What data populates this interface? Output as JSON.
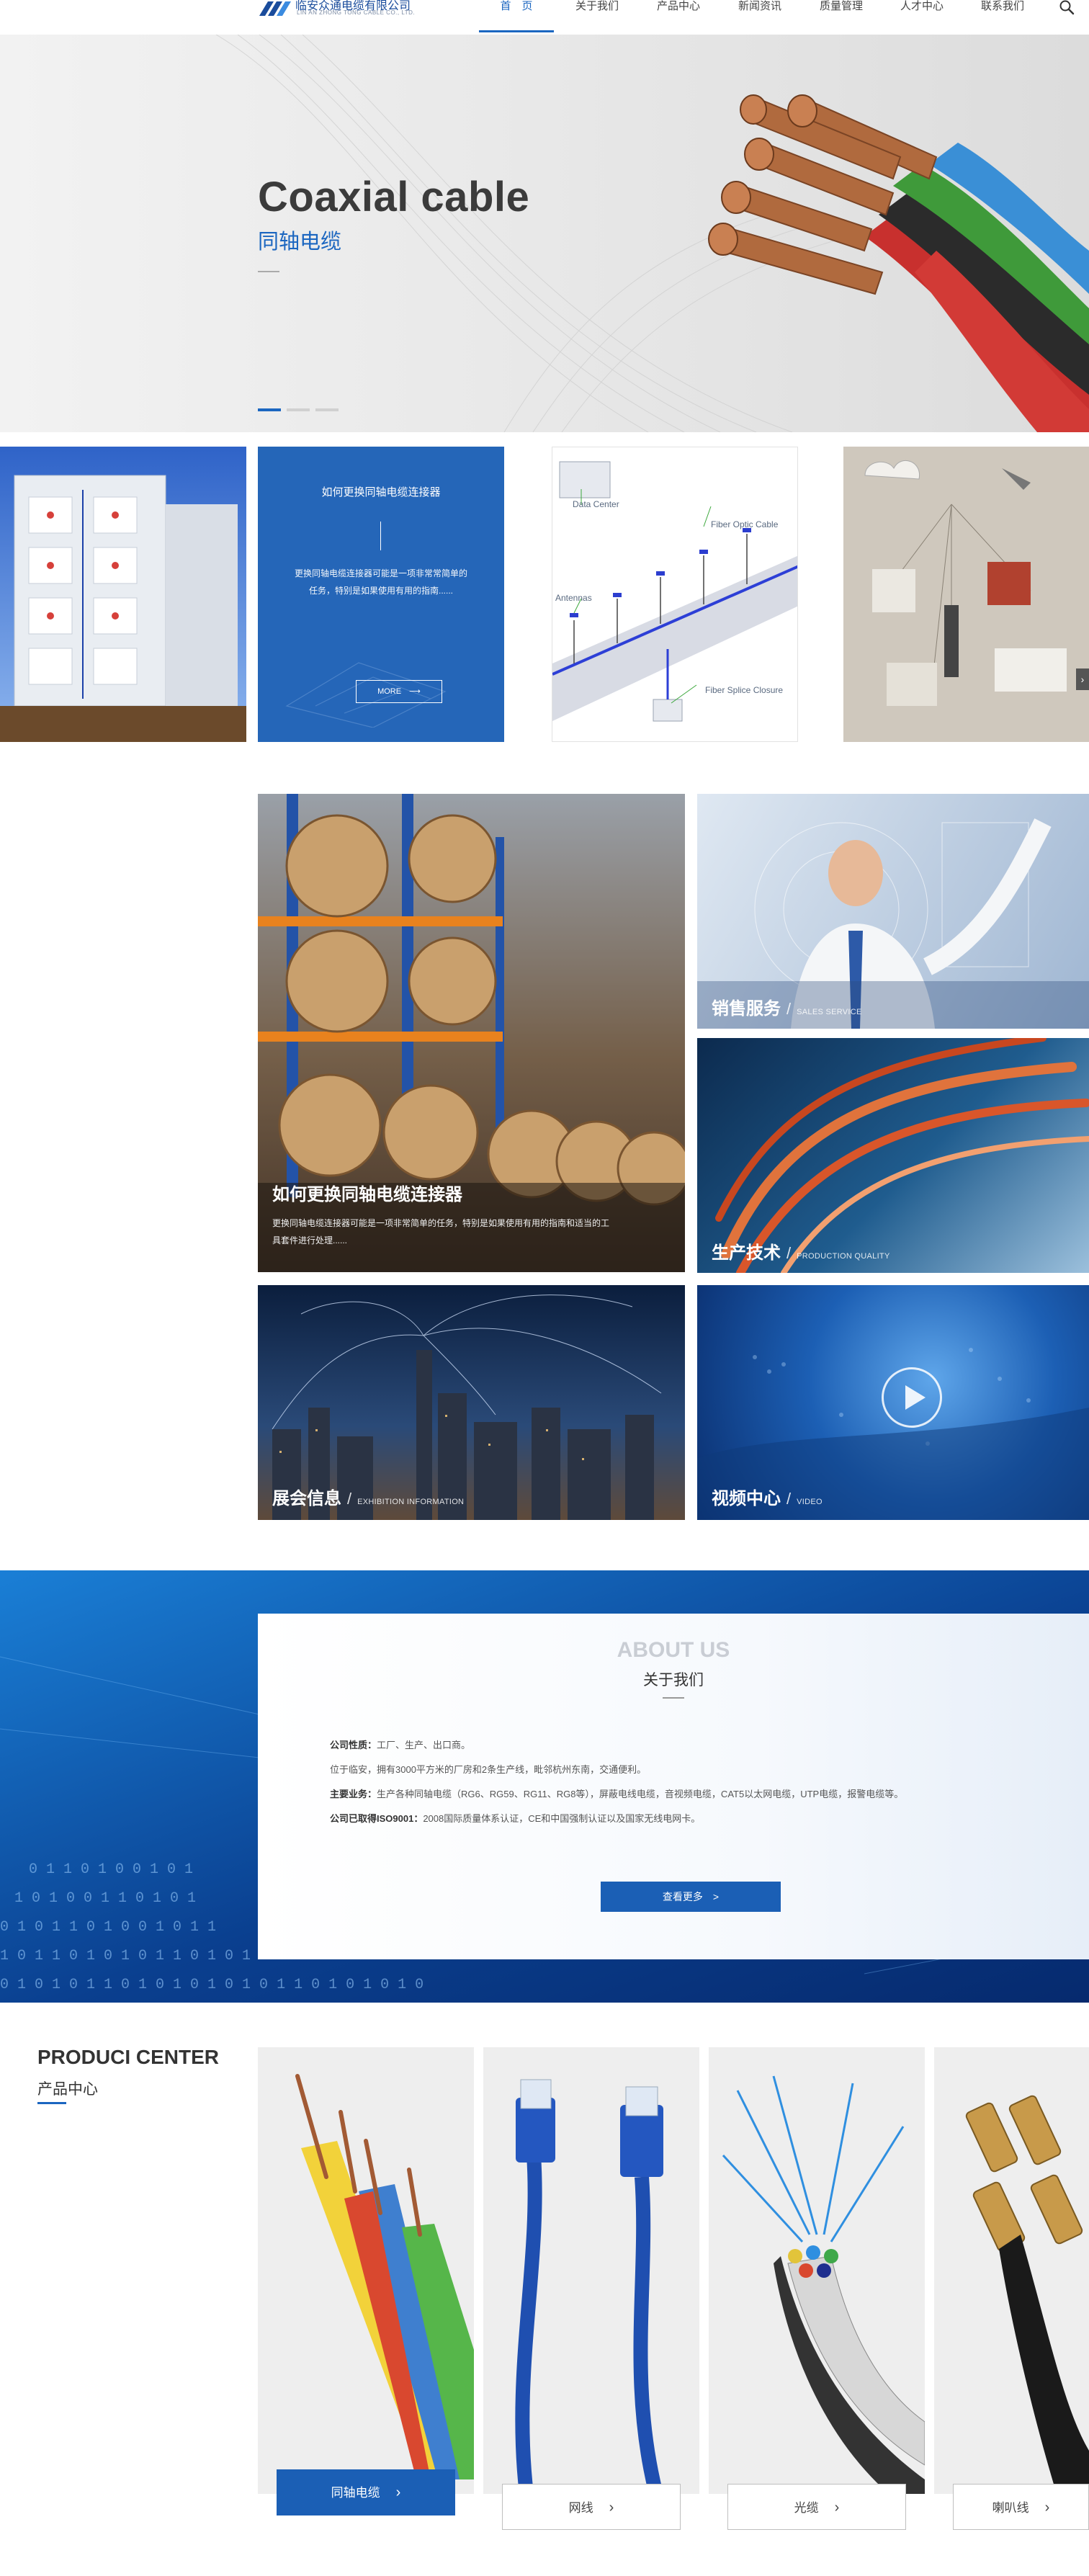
{
  "brand": {
    "name_cn": "临安众通电缆有限公司",
    "name_en": "LIN AN ZHONG TONG CABLE CO., LTD."
  },
  "nav": {
    "items": [
      "首　页",
      "关于我们",
      "产品中心",
      "新闻资讯",
      "质量管理",
      "人才中心",
      "联系我们"
    ],
    "active_index": 0,
    "search_icon": "search-icon"
  },
  "hero": {
    "title": "Coaxial cable",
    "subtitle": "同轴电缆",
    "slides_total": 3,
    "active_slide": 1
  },
  "cards": {
    "feature_title": "如何更换同轴电缆连接器",
    "feature_text": "更换同轴电缆连接器可能是一项非常常简单的任务，特别是如果使用有用的指南......",
    "feature_button": "MORE",
    "diagram_labels": {
      "data_center": "Data Center",
      "fiber_optic": "Fiber Optic Cable",
      "antennas": "Antennas",
      "closure": "Fiber Splice Closure"
    }
  },
  "grid": {
    "warehouse": {
      "title": "如何更换同轴电缆连接器",
      "text": "更换同轴电缆连接器可能是一项非常简单的任务，特别是如果使用有用的指南和适当的工具套件进行处理......"
    },
    "sales": {
      "cn": "销售服务",
      "sep": "/",
      "en": "SALES SERVICE"
    },
    "production": {
      "cn": "生产技术",
      "sep": "/",
      "en": "PRODUCTION QUALITY"
    },
    "exhibition": {
      "cn": "展会信息",
      "sep": "/",
      "en": "EXHIBITION INFORMATION"
    },
    "video": {
      "cn": "视频中心",
      "sep": "/",
      "en": "VIDEO"
    }
  },
  "about": {
    "heading_en": "ABOUT US",
    "heading_cn": "关于我们",
    "lines": [
      {
        "label": "公司性质：",
        "text": "工厂、生产、出口商。"
      },
      {
        "label": "",
        "text": "位于临安，拥有3000平方米的厂房和2条生产线，毗邻杭州东南，交通便利。"
      },
      {
        "label": "主要业务：",
        "text": "生产各种同轴电缆（RG6、RG59、RG11、RG8等），屏蔽电线电缆，音视频电缆，CAT5以太网电缆，UTP电缆，报警电缆等。"
      },
      {
        "label": "公司已取得ISO9001：",
        "text": "2008国际质量体系认证，CE和中国强制认证以及国家无线电网卡。"
      }
    ],
    "button": "查看更多　>"
  },
  "products": {
    "heading_en": "PRODUCI CENTER",
    "heading_cn": "产品中心",
    "items": [
      "同轴电缆",
      "网线",
      "光缆",
      "喇叭线"
    ],
    "active_index": 0
  },
  "colors": {
    "brand_blue": "#1b66c0",
    "accent_blue": "#2566b8",
    "dark_text": "#3b3b3b"
  }
}
